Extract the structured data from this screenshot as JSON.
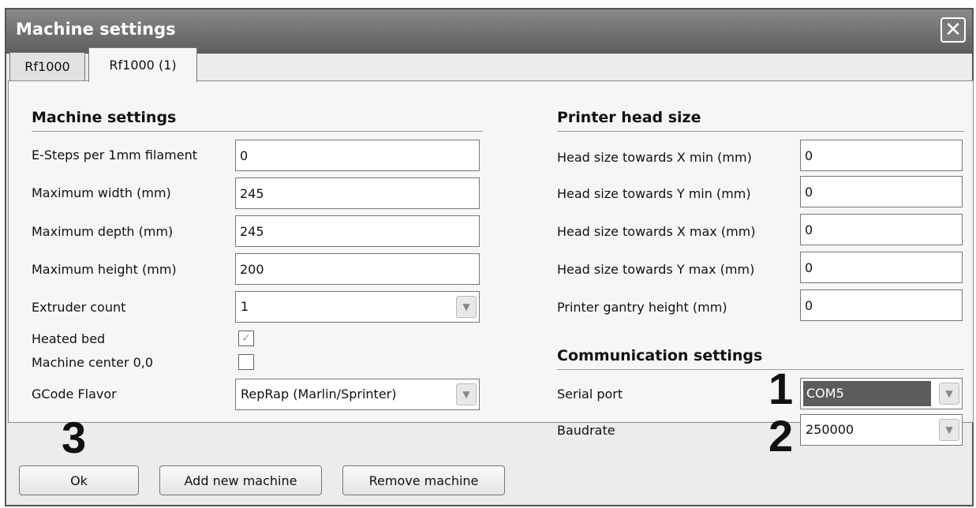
{
  "window": {
    "title": "Machine settings"
  },
  "tabs": [
    {
      "label": "Rf1000"
    },
    {
      "label": "Rf1000 (1)"
    }
  ],
  "machine": {
    "title": "Machine settings",
    "fields": [
      {
        "label": "E-Steps per 1mm filament",
        "value": "0"
      },
      {
        "label": "Maximum width (mm)",
        "value": "245"
      },
      {
        "label": "Maximum depth (mm)",
        "value": "245"
      },
      {
        "label": "Maximum height (mm)",
        "value": "200"
      }
    ],
    "extruder": {
      "label": "Extruder count",
      "value": "1"
    },
    "heated_bed": {
      "label": "Heated bed",
      "checked": true
    },
    "center": {
      "label": "Machine center 0,0",
      "checked": false
    },
    "gcode": {
      "label": "GCode Flavor",
      "value": "RepRap (Marlin/Sprinter)"
    }
  },
  "head": {
    "title": "Printer head size",
    "fields": [
      {
        "label": "Head size towards X min (mm)",
        "value": "0"
      },
      {
        "label": "Head size towards Y min (mm)",
        "value": "0"
      },
      {
        "label": "Head size towards X max (mm)",
        "value": "0"
      },
      {
        "label": "Head size towards Y max (mm)",
        "value": "0"
      },
      {
        "label": "Printer gantry height (mm)",
        "value": "0"
      }
    ]
  },
  "comm": {
    "title": "Communication settings",
    "serial": {
      "label": "Serial port",
      "value": "COM5"
    },
    "baud": {
      "label": "Baudrate",
      "value": "250000"
    }
  },
  "buttons": {
    "ok": "Ok",
    "add": "Add new machine",
    "remove": "Remove machine"
  },
  "callouts": {
    "one": "1",
    "two": "2",
    "three": "3"
  },
  "icons": {
    "close": "close-icon",
    "dropdown": "chevron-down-icon",
    "check": "checkmark-icon"
  }
}
